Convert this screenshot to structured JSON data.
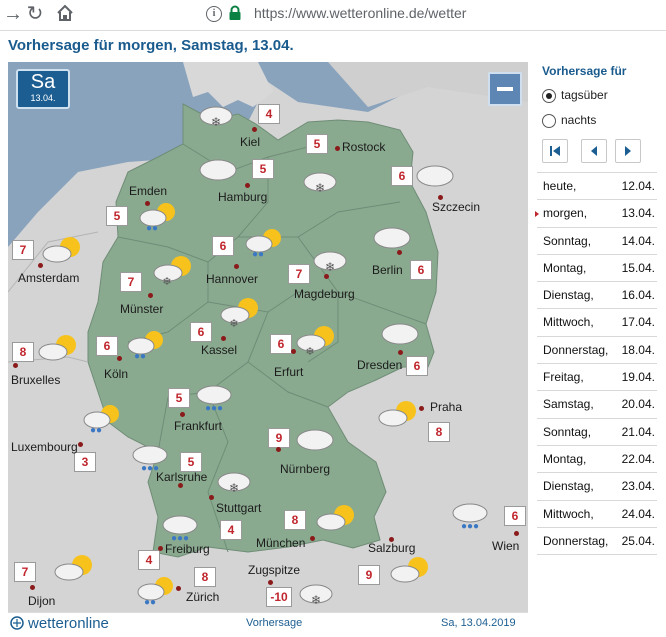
{
  "browser": {
    "url": "https://www.wetteronline.de/wetter"
  },
  "page": {
    "title": "Vorhersage für morgen, Samstag, 13.04."
  },
  "map": {
    "day_abbr": "Sa",
    "day_date": "13.04.",
    "cities": [
      {
        "name": "Kiel",
        "temp": "4",
        "icon": "snow-cloud-icon"
      },
      {
        "name": "Rostock",
        "temp": "5",
        "icon": "cloud-icon"
      },
      {
        "name": "Szczecin",
        "temp": "6",
        "icon": "cloud-icon"
      },
      {
        "name": "Hamburg",
        "temp": "5",
        "icon": "snow-cloud-icon"
      },
      {
        "name": "Emden",
        "temp": "5",
        "icon": "sun-rain-icon"
      },
      {
        "name": "Amsterdam",
        "temp": "7",
        "icon": "sun-cloud-icon"
      },
      {
        "name": "Hannover",
        "temp": "6",
        "icon": "sun-rain-icon"
      },
      {
        "name": "Berlin",
        "temp": "6",
        "icon": "cloud-icon"
      },
      {
        "name": "Magdeburg",
        "temp": "7",
        "icon": "snow-cloud-icon"
      },
      {
        "name": "Münster",
        "temp": "7",
        "icon": "sun-snow-icon"
      },
      {
        "name": "Kassel",
        "temp": "6",
        "icon": "sun-snow-icon"
      },
      {
        "name": "Köln",
        "temp": "6",
        "icon": "sun-rain-icon"
      },
      {
        "name": "Bruxelles",
        "temp": "8",
        "icon": "sun-cloud-icon"
      },
      {
        "name": "Erfurt",
        "temp": "6",
        "icon": "sun-snow-icon"
      },
      {
        "name": "Dresden",
        "temp": "6",
        "icon": "cloud-icon"
      },
      {
        "name": "Frankfurt",
        "temp": "5",
        "icon": "rain-cloud-icon"
      },
      {
        "name": "Praha",
        "temp": "8",
        "icon": "sun-cloud-icon"
      },
      {
        "name": "Luxembourg",
        "temp": "3",
        "icon": "sun-rain-icon"
      },
      {
        "name": "Nürnberg",
        "temp": "9",
        "icon": "cloud-icon"
      },
      {
        "name": "Karlsruhe",
        "temp": "5",
        "icon": "rain-cloud-icon"
      },
      {
        "name": "Stuttgart",
        "temp": "4",
        "icon": "snow-cloud-icon"
      },
      {
        "name": "München",
        "temp": "8",
        "icon": "sun-cloud-icon"
      },
      {
        "name": "Salzburg",
        "temp": "9",
        "icon": "sun-cloud-icon"
      },
      {
        "name": "Wien",
        "temp": "6",
        "icon": "rain-cloud-icon"
      },
      {
        "name": "Freiburg",
        "temp": "4",
        "icon": "rain-cloud-icon"
      },
      {
        "name": "Dijon",
        "temp": "7",
        "icon": "sun-cloud-icon"
      },
      {
        "name": "Zürich",
        "temp": "8",
        "icon": "sun-rain-icon"
      },
      {
        "name": "Zugspitze",
        "temp": "-10",
        "icon": "snow-cloud-icon"
      }
    ]
  },
  "footer": {
    "logo": "wetteronline",
    "label": "Vorhersage",
    "date": "Sa, 13.04.2019"
  },
  "sidebar": {
    "title": "Vorhersage für",
    "options": [
      {
        "label": "tagsüber",
        "selected": true
      },
      {
        "label": "nachts",
        "selected": false
      }
    ],
    "days": [
      {
        "name": "heute,",
        "date": "12.04."
      },
      {
        "name": "morgen,",
        "date": "13.04.",
        "active": true
      },
      {
        "name": "Sonntag,",
        "date": "14.04."
      },
      {
        "name": "Montag,",
        "date": "15.04."
      },
      {
        "name": "Dienstag,",
        "date": "16.04."
      },
      {
        "name": "Mittwoch,",
        "date": "17.04."
      },
      {
        "name": "Donnerstag,",
        "date": "18.04."
      },
      {
        "name": "Freitag,",
        "date": "19.04."
      },
      {
        "name": "Samstag,",
        "date": "20.04."
      },
      {
        "name": "Sonntag,",
        "date": "21.04."
      },
      {
        "name": "Montag,",
        "date": "22.04."
      },
      {
        "name": "Dienstag,",
        "date": "23.04."
      },
      {
        "name": "Mittwoch,",
        "date": "24.04."
      },
      {
        "name": "Donnerstag,",
        "date": "25.04."
      }
    ]
  },
  "colors": {
    "accent": "#1a5b8e",
    "map_sea": "#8aa3bd",
    "map_land": "#8aaa90",
    "map_neighbor": "#d5d5d5",
    "temp_text": "#c0262d"
  }
}
